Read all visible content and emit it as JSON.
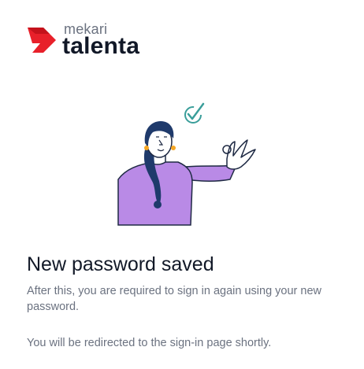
{
  "brand": {
    "sub": "mekari",
    "main": "talenta",
    "accent_color": "#e8202a"
  },
  "illustration": {
    "name": "woman-ok-gesture-illustration",
    "shirt_color": "#b98ae6",
    "check_color": "#3a9e9a"
  },
  "message": {
    "title": "New password saved",
    "description": "After this, you are required to sign in again using your new password.",
    "redirect": "You will be redirected to the sign-in page shortly."
  }
}
